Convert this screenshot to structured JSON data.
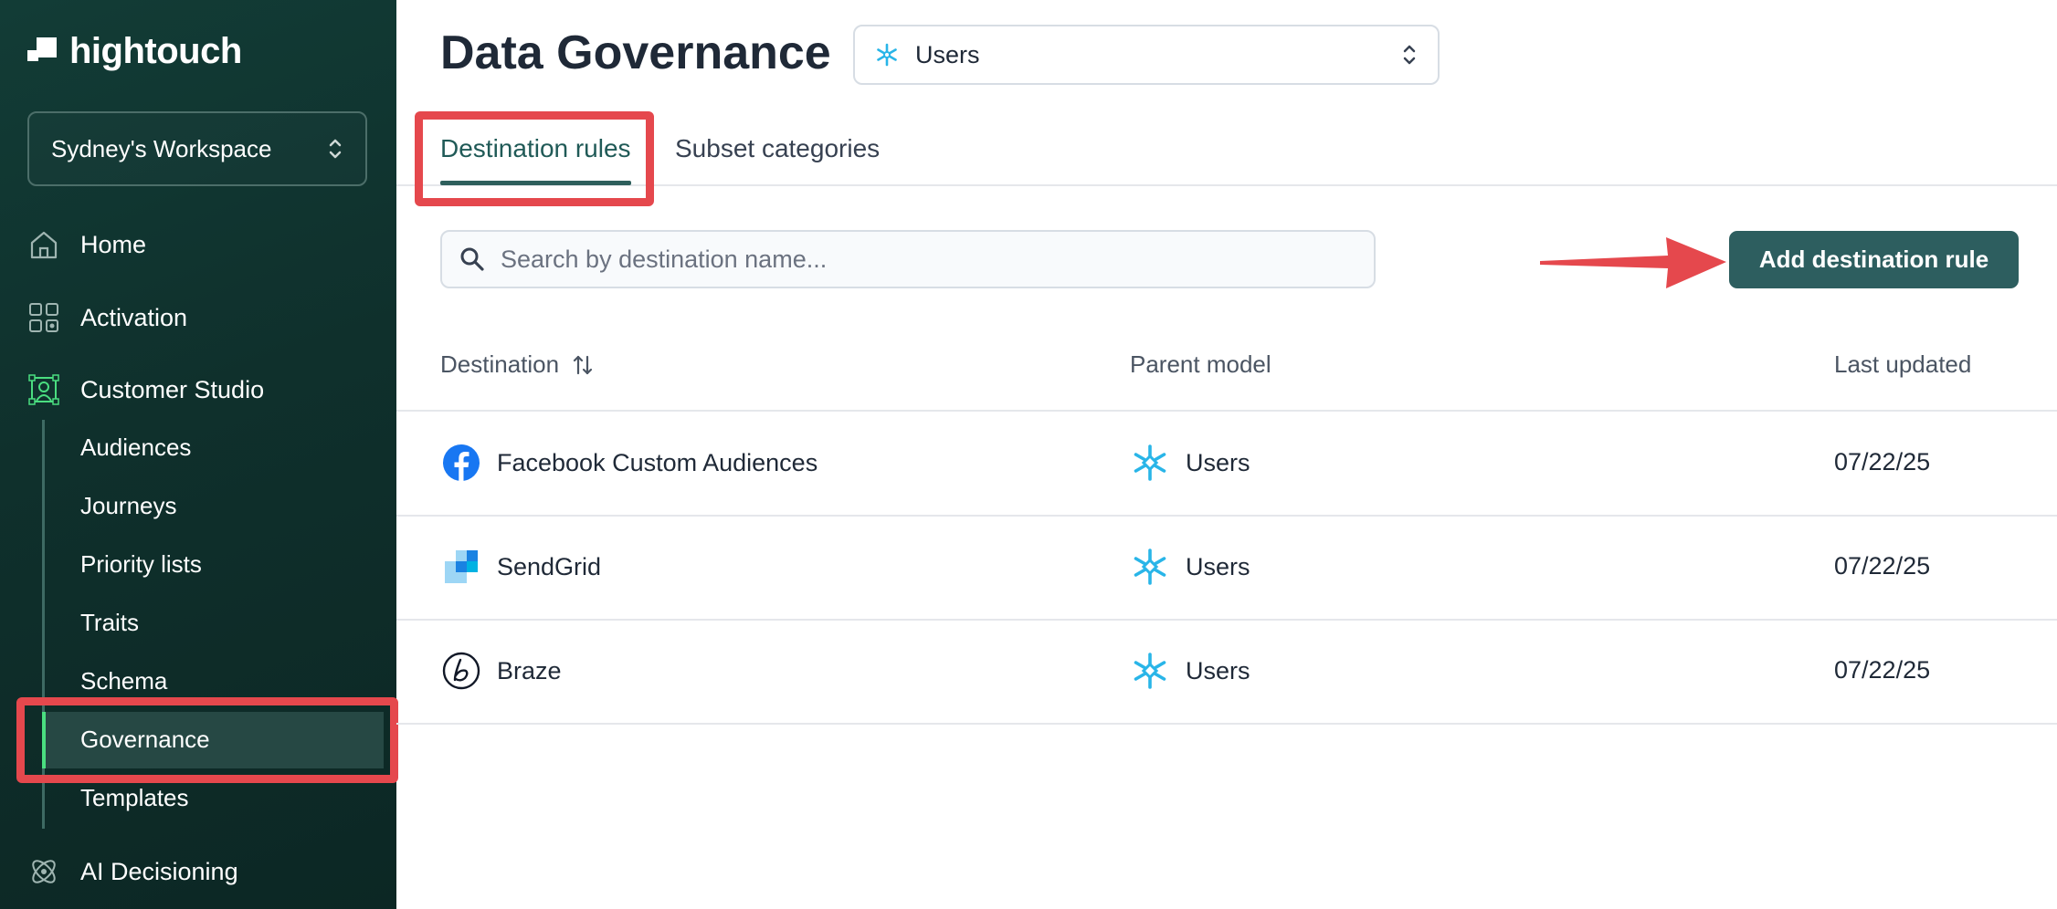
{
  "brand": {
    "name": "hightouch"
  },
  "workspace": {
    "label": "Sydney's Workspace"
  },
  "sidebar": {
    "items": [
      {
        "label": "Home",
        "icon": "home-icon"
      },
      {
        "label": "Activation",
        "icon": "activation-icon"
      },
      {
        "label": "Customer Studio",
        "icon": "customer-studio-icon"
      }
    ],
    "subitems": [
      "Audiences",
      "Journeys",
      "Priority lists",
      "Traits",
      "Schema",
      "Governance",
      "Templates"
    ],
    "active_subitem": "Governance",
    "bottom_item": {
      "label": "AI Decisioning",
      "icon": "ai-decisioning-icon"
    }
  },
  "header": {
    "title": "Data Governance",
    "model_select": {
      "value": "Users",
      "icon": "snowflake-icon"
    }
  },
  "tabs": [
    {
      "label": "Destination rules",
      "active": true
    },
    {
      "label": "Subset categories",
      "active": false
    }
  ],
  "search": {
    "placeholder": "Search by destination name..."
  },
  "actions": {
    "add_label": "Add destination rule"
  },
  "table": {
    "columns": [
      "Destination",
      "Parent model",
      "Last updated"
    ],
    "rows": [
      {
        "destination": "Facebook Custom Audiences",
        "icon": "facebook-icon",
        "parent_model": "Users",
        "last_updated": "07/22/25"
      },
      {
        "destination": "SendGrid",
        "icon": "sendgrid-icon",
        "parent_model": "Users",
        "last_updated": "07/22/25"
      },
      {
        "destination": "Braze",
        "icon": "braze-icon",
        "parent_model": "Users",
        "last_updated": "07/22/25"
      }
    ]
  },
  "colors": {
    "sidebar_bg": "#0f302c",
    "accent": "#2d5e5f",
    "active_indicator": "#4ade80",
    "annotation": "#e5484d",
    "snowflake": "#29b5e8",
    "facebook": "#1877f2"
  }
}
